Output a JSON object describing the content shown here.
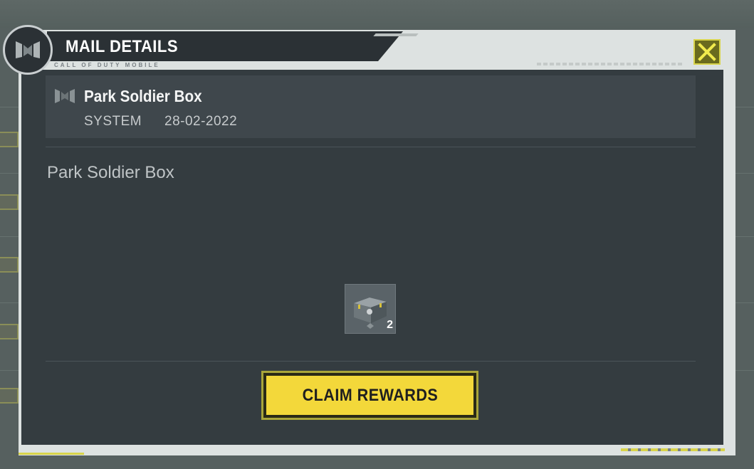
{
  "header": {
    "title": "MAIL DETAILS",
    "subtitle": "CALL OF DUTY MOBILE"
  },
  "mail": {
    "title": "Park Soldier Box",
    "sender": "SYSTEM",
    "date": "28-02-2022",
    "body_title": "Park Soldier Box"
  },
  "reward": {
    "count": "2",
    "icon": "crate-icon"
  },
  "actions": {
    "claim_label": "CLAIM REWARDS",
    "close_icon": "close-icon"
  },
  "colors": {
    "accent": "#f3d83a",
    "panel": "#343c40",
    "frame": "#dde2e1"
  }
}
